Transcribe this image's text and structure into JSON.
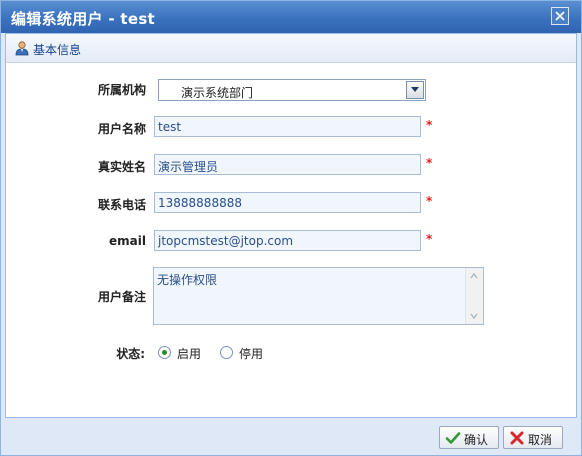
{
  "dialog": {
    "title": "编辑系统用户  - test",
    "close_icon": "close-icon"
  },
  "section": {
    "title": "基本信息",
    "icon": "user-icon"
  },
  "form": {
    "org": {
      "label": "所属机构",
      "value": "演示系统部门"
    },
    "username": {
      "label": "用户名称",
      "value": "test",
      "required": "*"
    },
    "realname": {
      "label": "真实姓名",
      "value": "演示管理员",
      "required": "*"
    },
    "phone": {
      "label": "联系电话",
      "value": "13888888888",
      "required": "*"
    },
    "email": {
      "label": "email",
      "value": "jtopcmstest@jtop.com",
      "required": "*"
    },
    "remark": {
      "label": "用户备注",
      "value": "无操作权限"
    },
    "status": {
      "label": "状态:",
      "options": [
        "启用",
        "停用"
      ],
      "selected": "启用"
    }
  },
  "buttons": {
    "confirm": "确认",
    "cancel": "取消"
  },
  "colors": {
    "title_bar": "#3b72bf",
    "panel_bg": "#dfe8f6",
    "required": "#e02020",
    "field_text": "#2a4f8a"
  }
}
